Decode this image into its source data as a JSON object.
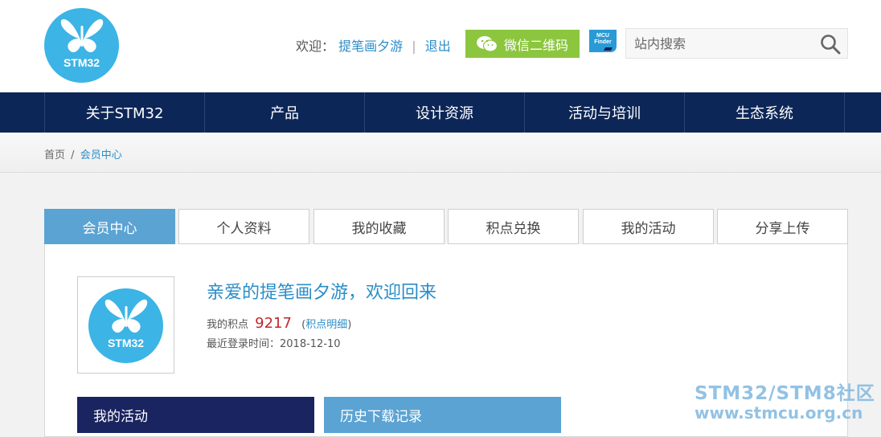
{
  "header": {
    "logo_text": "STM32",
    "welcome_prefix": "欢迎：",
    "username": "提笔画夕游",
    "separator": "|",
    "logout": "退出",
    "wechat_button": "微信二维码",
    "mcu_finder_line1": "MCU",
    "mcu_finder_line2": "Finder",
    "search_placeholder": "站内搜索"
  },
  "nav": {
    "items": [
      "关于STM32",
      "产品",
      "设计资源",
      "活动与培训",
      "生态系统"
    ]
  },
  "breadcrumb": {
    "home": "首页",
    "sep": "/",
    "current": "会员中心"
  },
  "tabs": [
    "会员中心",
    "个人资料",
    "我的收藏",
    "积点兑换",
    "我的活动",
    "分享上传"
  ],
  "member": {
    "avatar_text": "STM32",
    "greeting": "亲爱的提笔画夕游，欢迎回来",
    "points_label": "我的积点",
    "points_value": "9217",
    "points_detail": "积点明细",
    "last_login": "最近登录时间：2018-12-10"
  },
  "sections": {
    "my_activity": "我的活动",
    "download_history": "历史下载记录"
  },
  "watermark": {
    "line1": "STM32/STM8社区",
    "line2": "www.stmcu.org.cn"
  },
  "colors": {
    "nav_bg": "#0c2657",
    "accent_blue": "#2a8dc8",
    "tab_active": "#5ba3d3",
    "wechat_green": "#8cc63f",
    "points_red": "#c0282d",
    "logo_blue": "#3cb4e5"
  }
}
